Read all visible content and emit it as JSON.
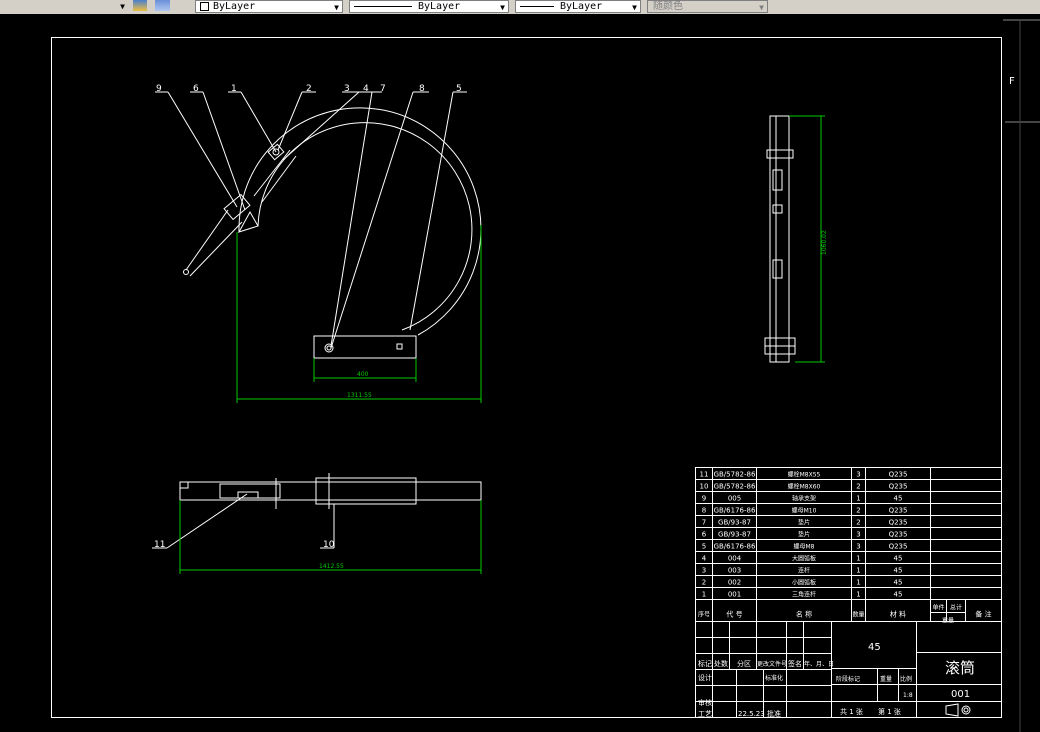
{
  "toolbar": {
    "layer_dropdown_value": "",
    "color_dropdown_value": "ByLayer",
    "linetype_dropdown_value": "ByLayer",
    "lineweight_dropdown_value": "ByLayer",
    "plotstyle_dropdown_value": "随颜色"
  },
  "side_label": "F",
  "top_view": {
    "balloons": [
      "9",
      "6",
      "1",
      "2",
      "3",
      "4",
      "7",
      "8",
      "5"
    ],
    "dim_inner": "400",
    "dim_overall": "1311.55"
  },
  "side_view": {
    "dim_height": "1060.02"
  },
  "bottom_view": {
    "balloons": [
      "11",
      "10"
    ],
    "dim_overall": "1412.55"
  },
  "parts_list": {
    "rows": [
      {
        "no": "11",
        "code": "GB/5782-86",
        "name": "螺栓M8X55",
        "qty": "3",
        "material": "Q235"
      },
      {
        "no": "10",
        "code": "GB/5782-86",
        "name": "螺栓M8X60",
        "qty": "2",
        "material": "Q235"
      },
      {
        "no": "9",
        "code": "005",
        "name": "轴承支架",
        "qty": "1",
        "material": "45"
      },
      {
        "no": "8",
        "code": "GB/6176-86",
        "name": "螺母M10",
        "qty": "2",
        "material": "Q235"
      },
      {
        "no": "7",
        "code": "GB/93-87",
        "name": "垫片",
        "qty": "2",
        "material": "Q235"
      },
      {
        "no": "6",
        "code": "GB/93-87",
        "name": "垫片",
        "qty": "3",
        "material": "Q235"
      },
      {
        "no": "5",
        "code": "GB/6176-86",
        "name": "螺母M8",
        "qty": "3",
        "material": "Q235"
      },
      {
        "no": "4",
        "code": "004",
        "name": "大圆弧板",
        "qty": "1",
        "material": "45"
      },
      {
        "no": "3",
        "code": "003",
        "name": "连杆",
        "qty": "1",
        "material": "45"
      },
      {
        "no": "2",
        "code": "002",
        "name": "小圆弧板",
        "qty": "1",
        "material": "45"
      },
      {
        "no": "1",
        "code": "001",
        "name": "三角连杆",
        "qty": "1",
        "material": "45"
      }
    ],
    "header": {
      "no": "序号",
      "code": "代 号",
      "name": "名 称",
      "qty": "数量",
      "material": "材 料",
      "unit_weight": "单件",
      "total_weight": "总计",
      "weight": "重量",
      "remark": "备 注"
    }
  },
  "title_block": {
    "material": "45",
    "part_name": "滚筒",
    "drawing_no": "001",
    "scale": "1:8",
    "date": "22.5.23",
    "labels": {
      "mark": "标记",
      "count": "处数",
      "zone": "分区",
      "doc_no": "更改文件号",
      "sign": "签名",
      "ymd": "年、月、日",
      "design": "设计",
      "standardize": "标准化",
      "stage_mark": "阶段标记",
      "weight": "重量",
      "scale": "比例",
      "review": "审核",
      "process": "工艺",
      "approve": "批准",
      "sheets_total": "共 1 张",
      "sheet_no": "第 1 张"
    }
  },
  "colors": {
    "line": "#ffffff",
    "dimension": "#00c800",
    "border": "#ffffff",
    "background": "#000000",
    "toolbar": "#d4d0c8"
  }
}
